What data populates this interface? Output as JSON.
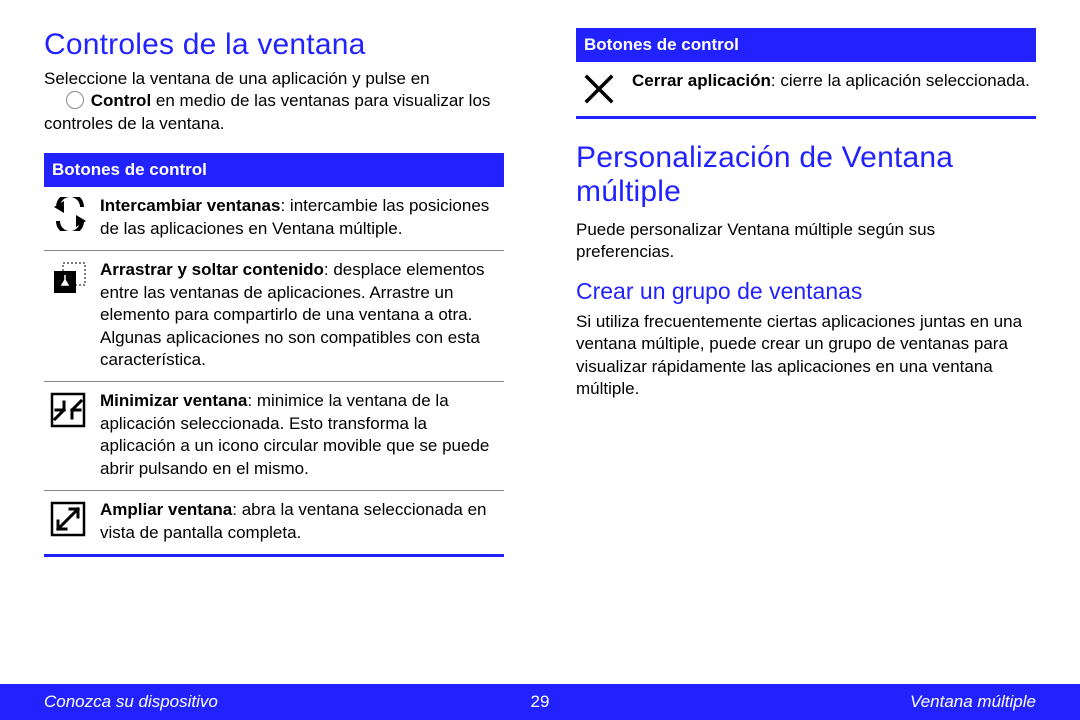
{
  "left": {
    "title": "Controles de la ventana",
    "intro_before": "Seleccione la ventana de una aplicación y pulse en ",
    "intro_bold": "Control",
    "intro_after": " en medio de las ventanas para visualizar los controles de la ventana.",
    "table_header": "Botones de control",
    "items": [
      {
        "bold": "Intercambiar ventanas",
        "rest": ": intercambie las posiciones de las aplicaciones en Ventana múltiple."
      },
      {
        "bold": "Arrastrar y soltar contenido",
        "rest": ": desplace elementos entre las ventanas de aplicaciones. Arrastre un elemento para compartirlo de una ventana a otra. Algunas aplicaciones no son compatibles con esta característica."
      },
      {
        "bold": "Minimizar ventana",
        "rest": ": minimice la ventana de la aplicación seleccionada. Esto transforma la aplicación a un icono circular movible que se puede abrir pulsando en el mismo."
      },
      {
        "bold": "Ampliar ventana",
        "rest": ": abra la ventana seleccionada en vista de pantalla completa."
      }
    ]
  },
  "right": {
    "table_header": "Botones de control",
    "close_bold": "Cerrar aplicación",
    "close_rest": ": cierre la aplicación seleccionada.",
    "title": "Personalización de Ventana múltiple",
    "para": "Puede personalizar Ventana múltiple según sus preferencias.",
    "subtitle": "Crear un grupo de ventanas",
    "para2": "Si utiliza frecuentemente ciertas aplicaciones juntas en una ventana múltiple, puede crear un grupo de ventanas para visualizar rápidamente las aplicaciones en una ventana múltiple."
  },
  "footer": {
    "left": "Conozca su dispositivo",
    "page": "29",
    "right": "Ventana múltiple"
  }
}
